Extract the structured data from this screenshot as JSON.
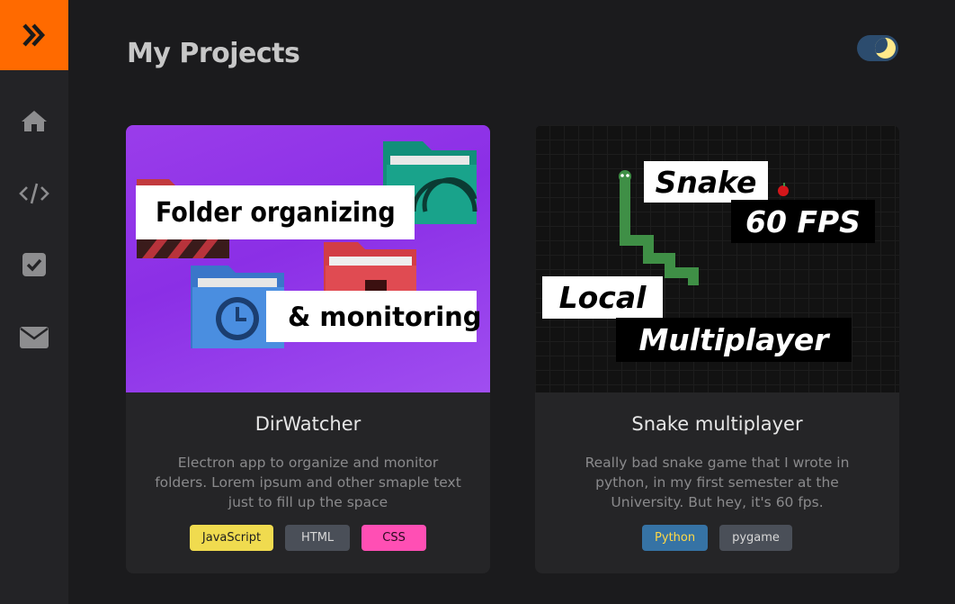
{
  "page": {
    "title": "My Projects"
  },
  "sidebar": {
    "toggle_icon": "double-chevron-right-icon",
    "items": [
      {
        "id": "home",
        "icon": "home-icon"
      },
      {
        "id": "code",
        "icon": "code-icon"
      },
      {
        "id": "tasks",
        "icon": "checkbox-icon"
      },
      {
        "id": "contact",
        "icon": "envelope-icon"
      }
    ]
  },
  "theme_toggle": {
    "icon": "moon-icon",
    "state": "dark"
  },
  "colors": {
    "accent": "#ff6a00",
    "background": "#1b1b1d",
    "sidebar": "#232326",
    "card": "#252527"
  },
  "projects": [
    {
      "title": "DirWatcher",
      "description": "Electron app to organize and monitor folders. Lorem ipsum and other smaple text just to fill up the space",
      "image": {
        "banner_1": "Folder organizing",
        "banner_2": "& monitoring"
      },
      "tags": [
        {
          "label": "JavaScript",
          "bg": "#f0db4f",
          "fg": "#1e1e1e"
        },
        {
          "label": "HTML",
          "bg": "#4a4f58",
          "fg": "#d7d7d7"
        },
        {
          "label": "CSS",
          "bg": "#ff4fb4",
          "fg": "#2a0a1e"
        }
      ]
    },
    {
      "title": "Snake multiplayer",
      "description": "Really bad snake game that I wrote in python, in my first semester at the University. But hey, it's 60 fps.",
      "image": {
        "banner_1": "Snake",
        "banner_2": "60 FPS",
        "banner_3": "Local",
        "banner_4": "Multiplayer"
      },
      "tags": [
        {
          "label": "Python",
          "bg": "#3673a5",
          "fg": "#ffd845"
        },
        {
          "label": "pygame",
          "bg": "#4a4f58",
          "fg": "#d7d7d7"
        }
      ]
    }
  ]
}
